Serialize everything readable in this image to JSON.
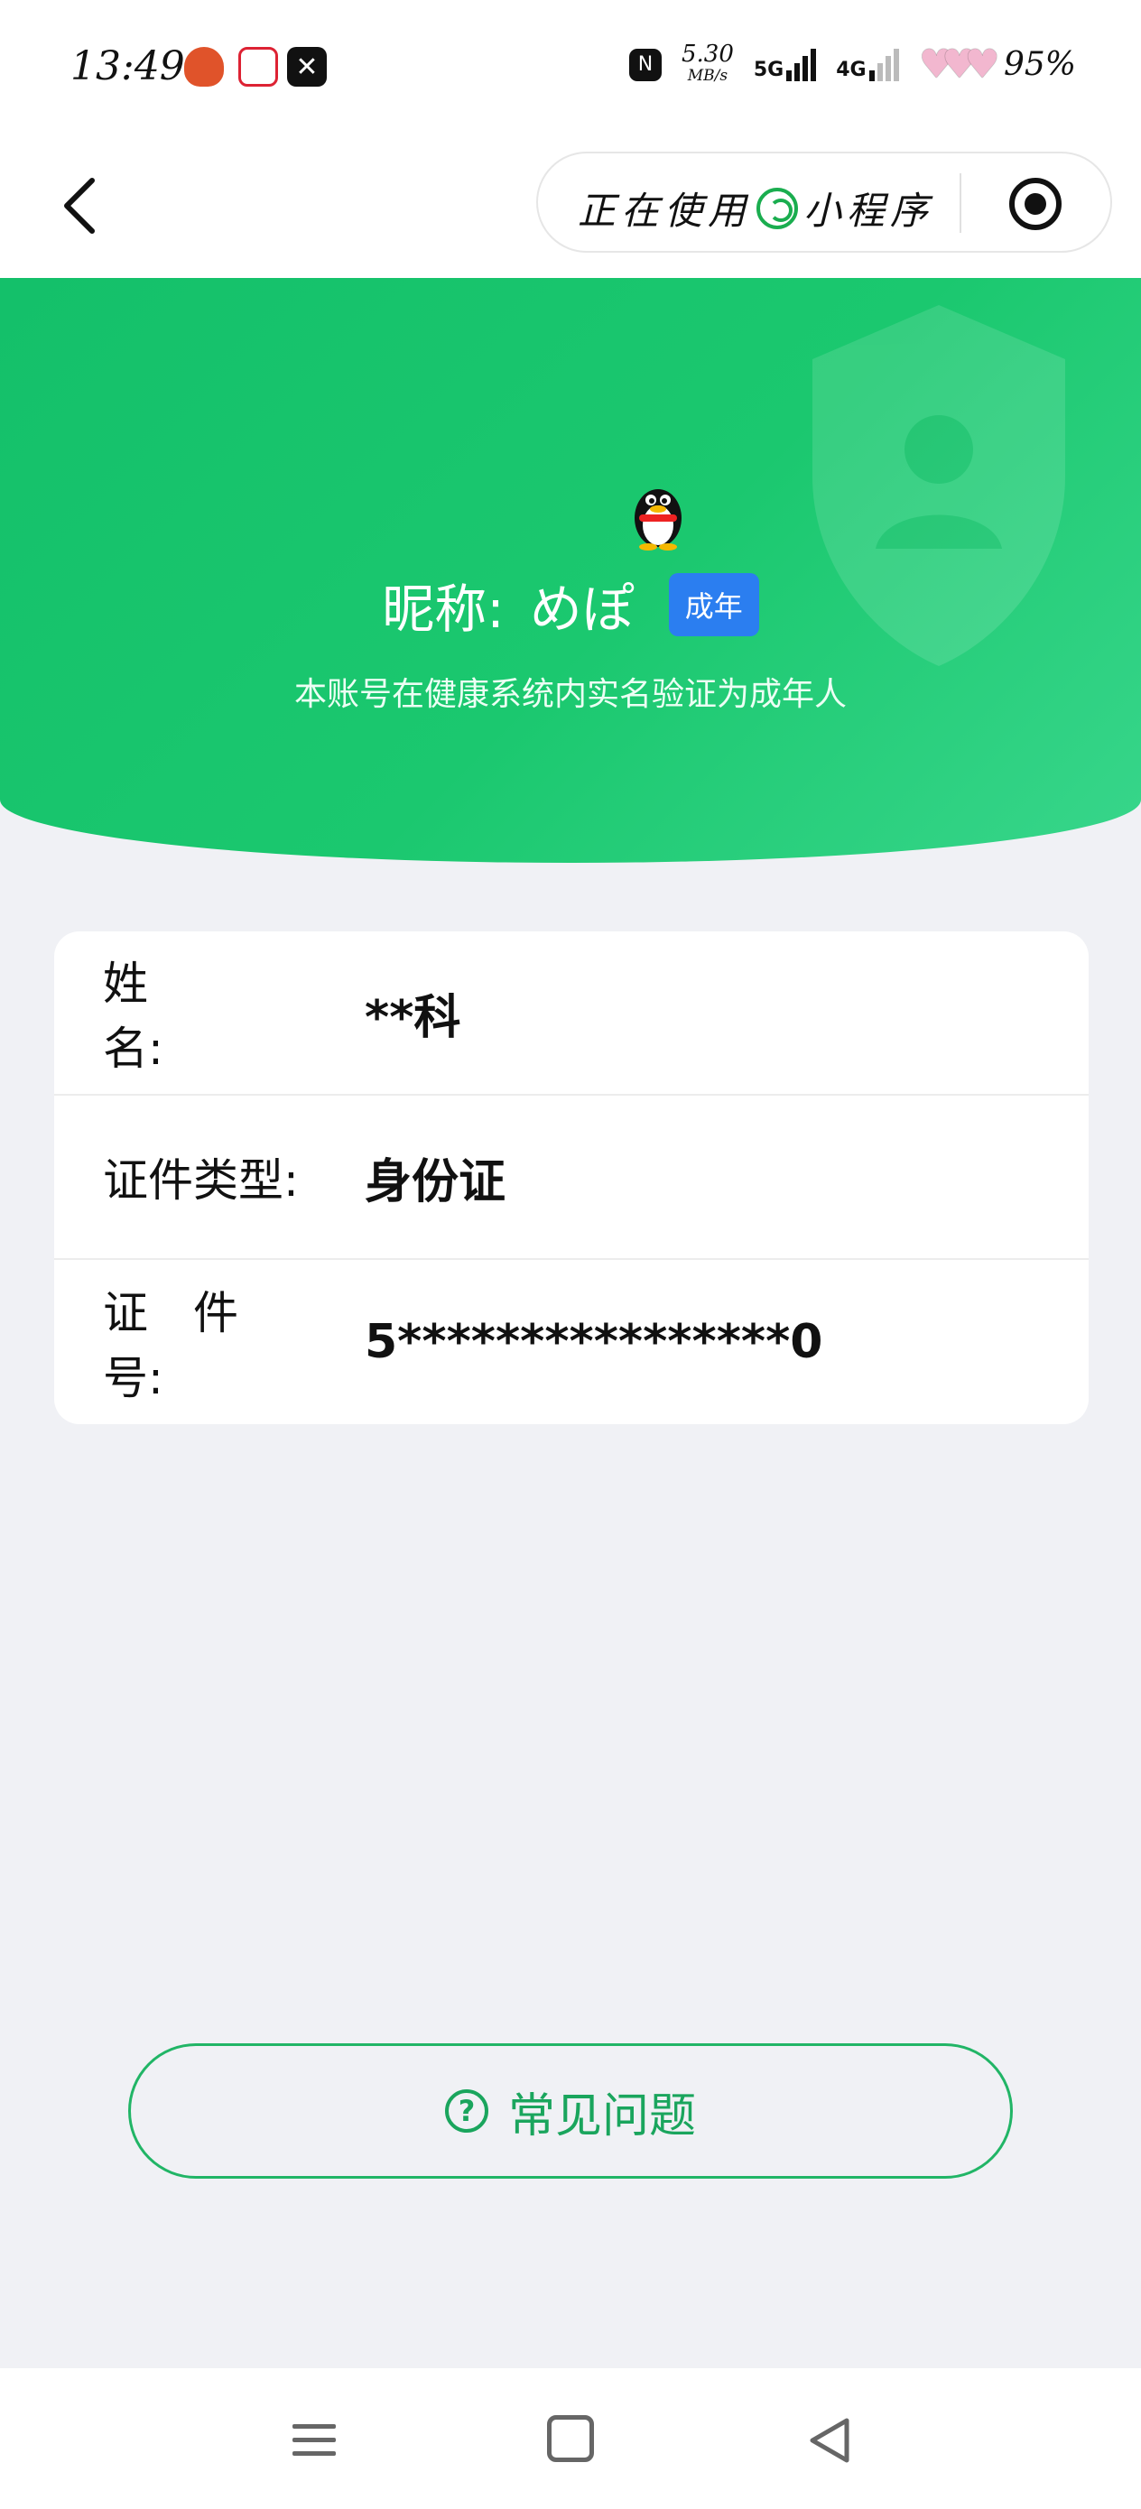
{
  "status_bar": {
    "time": "13:49",
    "app_icons": [
      "app-icon-1",
      "app-icon-2",
      "capcut-icon"
    ],
    "nfc_label": "N",
    "net_speed": "5.30",
    "net_speed_unit": "MB/s",
    "signal1_label": "5G",
    "signal2_label": "4G",
    "battery_pct": "95%"
  },
  "nav": {
    "capsule_prefix": "正在使用",
    "capsule_suffix": "小程序"
  },
  "profile": {
    "nickname_label": "昵称:",
    "nickname": "めぽ",
    "badge": "成年",
    "description": "本账号在健康系统内实名验证为成年人"
  },
  "info": {
    "rows": [
      {
        "label": "姓　　　名:",
        "value": "**科"
      },
      {
        "label": "证件类型:",
        "value": "身份证"
      },
      {
        "label": "证　件　号:",
        "value": "5****************0"
      }
    ]
  },
  "faq": {
    "label": "常见问题",
    "icon_glyph": "?"
  },
  "colors": {
    "brand_green": "#1bc86f",
    "badge_blue": "#2b7ef0",
    "page_bg": "#f0f1f5"
  }
}
